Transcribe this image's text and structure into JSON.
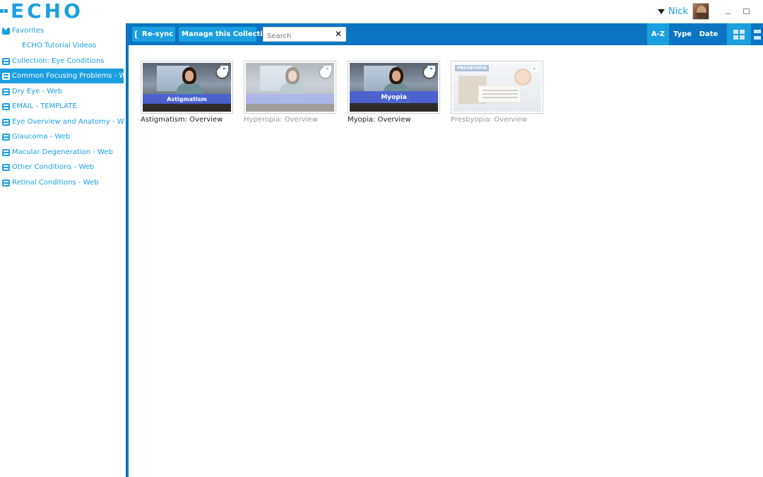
{
  "app": {
    "logo_text": "ECHO",
    "accent_color": "#1ba0e0",
    "toolbar_color": "#0b75c3"
  },
  "header": {
    "user_name": "Nick",
    "user_menu_icon": "caret-down-icon",
    "minimize_icon": "minimize-icon",
    "maximize_icon": "maximize-icon"
  },
  "sidebar": {
    "items": [
      {
        "label": "Favorites",
        "icon": "heart-icon",
        "active": false
      },
      {
        "label": "ECHO Tutorial Videos",
        "icon": "",
        "active": false
      },
      {
        "label": "Collection: Eye Conditions",
        "icon": "folder-icon",
        "active": false
      },
      {
        "label": "Common Focusing Problems - Web",
        "icon": "folder-icon",
        "active": true
      },
      {
        "label": "Dry Eye - Web",
        "icon": "folder-icon",
        "active": false
      },
      {
        "label": "EMAIL - TEMPLATE",
        "icon": "folder-icon",
        "active": false
      },
      {
        "label": "Eye Overview and Anatomy - Web",
        "icon": "folder-icon",
        "active": false
      },
      {
        "label": "Glaucoma - Web",
        "icon": "folder-icon",
        "active": false
      },
      {
        "label": "Macular Degeneration - Web",
        "icon": "folder-icon",
        "active": false
      },
      {
        "label": "Other Conditions - Web",
        "icon": "folder-icon",
        "active": false
      },
      {
        "label": "Retinal Conditions - Web",
        "icon": "folder-icon",
        "active": false
      }
    ]
  },
  "toolbar": {
    "resync_label": "Re-sync",
    "manage_label": "Manage this Collection",
    "search_placeholder": "Search",
    "search_value": "",
    "clear_icon": "close-icon",
    "sort_options": [
      "A-Z",
      "Type",
      "Date"
    ],
    "sort_selected": "A-Z",
    "view_modes": [
      "grid-view-icon",
      "list-view-icon"
    ],
    "view_selected": "grid-view-icon"
  },
  "content": {
    "videos": [
      {
        "title": "Astigmatism: Overview",
        "thumb_banner": "Astigmatism",
        "dimmed": false
      },
      {
        "title": "Hyperopia: Overview",
        "thumb_banner": "",
        "dimmed": true
      },
      {
        "title": "Myopia: Overview",
        "thumb_banner": "Myopia",
        "dimmed": false
      },
      {
        "title": "Presbyopia: Overview",
        "thumb_banner": "PRESBYOPIA",
        "dimmed": true
      }
    ]
  }
}
